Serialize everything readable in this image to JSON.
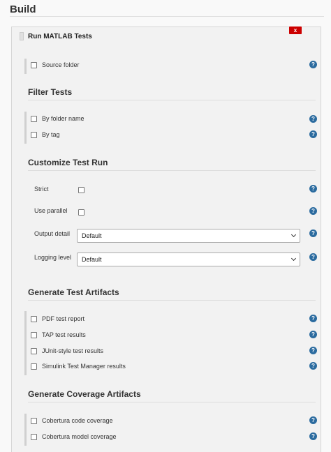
{
  "header": {
    "title": "Build"
  },
  "step": {
    "title": "Run MATLAB Tests",
    "close_label": "x"
  },
  "source": {
    "label": "Source folder"
  },
  "filter": {
    "title": "Filter Tests",
    "items": [
      "By folder name",
      "By tag"
    ]
  },
  "customize": {
    "title": "Customize Test Run",
    "strict_label": "Strict",
    "parallel_label": "Use parallel",
    "output_label": "Output detail",
    "output_value": "Default",
    "logging_label": "Logging level",
    "logging_value": "Default"
  },
  "artifacts": {
    "title": "Generate Test Artifacts",
    "items": [
      "PDF test report",
      "TAP test results",
      "JUnit-style test results",
      "Simulink Test Manager results"
    ]
  },
  "coverage": {
    "title": "Generate Coverage Artifacts",
    "items": [
      "Cobertura code coverage",
      "Cobertura model coverage"
    ]
  },
  "help_symbol": "?",
  "colors": {
    "close": "#cc0000",
    "help": "#2b6b9f"
  }
}
